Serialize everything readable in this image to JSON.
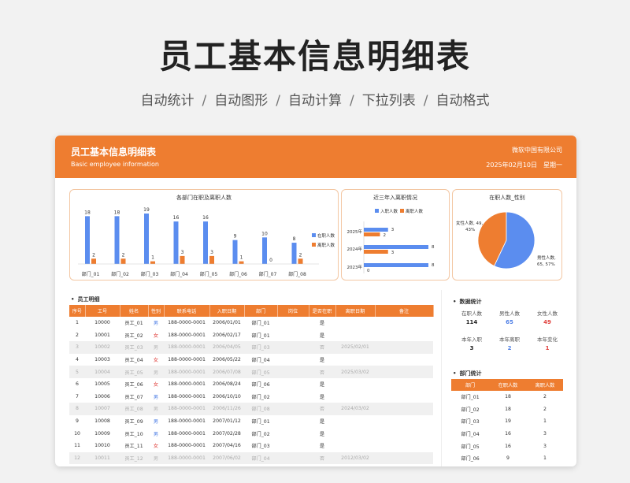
{
  "hero": {
    "title": "员工基本信息明细表",
    "features": [
      "自动统计",
      "自动图形",
      "自动计算",
      "下拉列表",
      "自动格式"
    ],
    "separator": "/"
  },
  "header": {
    "title": "员工基本信息明细表",
    "subtitle": "Basic employee information",
    "company": "微软中国有限公司",
    "date": "2025年02月10日",
    "weekday": "星期一"
  },
  "colors": {
    "accent": "#ee7d30",
    "blue": "#5b8def",
    "male": "#4f7fe6",
    "female": "#e0403c"
  },
  "chart_data": [
    {
      "type": "bar",
      "title": "各部门在职及离职人数",
      "categories": [
        "部门_01",
        "部门_02",
        "部门_03",
        "部门_04",
        "部门_05",
        "部门_06",
        "部门_07",
        "部门_08"
      ],
      "series": [
        {
          "name": "在职人数",
          "values": [
            18,
            18,
            19,
            16,
            16,
            9,
            10,
            8
          ]
        },
        {
          "name": "离职人数",
          "values": [
            2,
            2,
            1,
            3,
            3,
            1,
            0,
            2
          ]
        }
      ],
      "ylim": [
        0,
        20
      ],
      "legend": "right"
    },
    {
      "type": "bar",
      "orientation": "horizontal",
      "title": "近三年入离职情况",
      "categories": [
        "2025年",
        "2024年",
        "2023年"
      ],
      "series": [
        {
          "name": "入职人数",
          "values": [
            3,
            8,
            8
          ]
        },
        {
          "name": "离职人数",
          "values": [
            2,
            3,
            0
          ]
        }
      ],
      "legend": "top"
    },
    {
      "type": "pie",
      "title": "在职人数_性别",
      "labels": [
        "女性人数",
        "男性人数"
      ],
      "values": [
        49,
        65
      ],
      "percents": [
        "43%",
        "57%"
      ]
    }
  ],
  "employee": {
    "section_title": "员工明细",
    "columns": [
      "序号",
      "工号",
      "姓名",
      "性别",
      "联系电话",
      "入职日期",
      "部门",
      "岗位",
      "是否在职",
      "离职日期",
      "备注"
    ],
    "rows": [
      [
        "1",
        "10000",
        "员工_01",
        "男",
        "188-0000-0001",
        "2006/01/01",
        "部门_01",
        "",
        "是",
        "",
        ""
      ],
      [
        "2",
        "10001",
        "员工_02",
        "女",
        "188-0000-0001",
        "2006/02/17",
        "部门_01",
        "",
        "是",
        "",
        ""
      ],
      [
        "3",
        "10002",
        "员工_03",
        "男",
        "188-0000-0001",
        "2006/04/05",
        "部门_03",
        "",
        "否",
        "2025/02/01",
        ""
      ],
      [
        "4",
        "10003",
        "员工_04",
        "女",
        "188-0000-0001",
        "2006/05/22",
        "部门_04",
        "",
        "是",
        "",
        ""
      ],
      [
        "5",
        "10004",
        "员工_05",
        "男",
        "188-0000-0001",
        "2006/07/08",
        "部门_05",
        "",
        "否",
        "2025/03/02",
        ""
      ],
      [
        "6",
        "10005",
        "员工_06",
        "女",
        "188-0000-0001",
        "2006/08/24",
        "部门_06",
        "",
        "是",
        "",
        ""
      ],
      [
        "7",
        "10006",
        "员工_07",
        "男",
        "188-0000-0001",
        "2006/10/10",
        "部门_02",
        "",
        "是",
        "",
        ""
      ],
      [
        "8",
        "10007",
        "员工_08",
        "男",
        "188-0000-0001",
        "2006/11/26",
        "部门_08",
        "",
        "否",
        "2024/03/02",
        ""
      ],
      [
        "9",
        "10008",
        "员工_09",
        "男",
        "188-0000-0001",
        "2007/01/12",
        "部门_01",
        "",
        "是",
        "",
        ""
      ],
      [
        "10",
        "10009",
        "员工_10",
        "男",
        "188-0000-0001",
        "2007/02/28",
        "部门_02",
        "",
        "是",
        "",
        ""
      ],
      [
        "11",
        "10010",
        "员工_11",
        "女",
        "188-0000-0001",
        "2007/04/16",
        "部门_03",
        "",
        "是",
        "",
        ""
      ],
      [
        "12",
        "10011",
        "员工_12",
        "男",
        "188-0000-0001",
        "2007/06/02",
        "部门_04",
        "",
        "否",
        "2012/03/02",
        ""
      ]
    ]
  },
  "stats": {
    "section_title": "数据统计",
    "row1": [
      {
        "label": "在职人数",
        "value": "114",
        "color": "#222"
      },
      {
        "label": "男性人数",
        "value": "65",
        "color": "#4f7fe6"
      },
      {
        "label": "女性人数",
        "value": "49",
        "color": "#e0403c"
      }
    ],
    "row2": [
      {
        "label": "本年入职",
        "value": "3",
        "color": "#222"
      },
      {
        "label": "本年离职",
        "value": "2",
        "color": "#4f7fe6"
      },
      {
        "label": "本年变化",
        "value": "1",
        "color": "#e0403c"
      }
    ]
  },
  "dept": {
    "section_title": "部门统计",
    "columns": [
      "部门",
      "在职人数",
      "离职人数"
    ],
    "rows": [
      [
        "部门_01",
        "18",
        "2"
      ],
      [
        "部门_02",
        "18",
        "2"
      ],
      [
        "部门_03",
        "19",
        "1"
      ],
      [
        "部门_04",
        "16",
        "3"
      ],
      [
        "部门_05",
        "16",
        "3"
      ],
      [
        "部门_06",
        "9",
        "1"
      ]
    ]
  }
}
